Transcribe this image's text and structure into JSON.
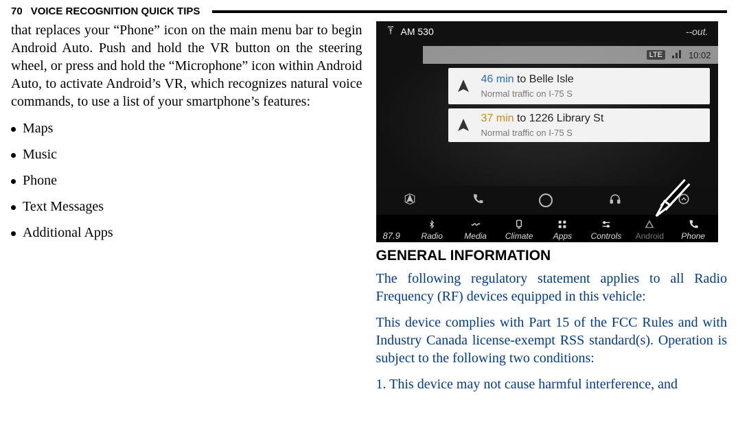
{
  "header": {
    "page_number": "70",
    "section": "VOICE RECOGNITION QUICK TIPS"
  },
  "left": {
    "paragraph": "that replaces your “Phone” icon on the main menu bar to begin Android Auto. Push and hold the VR button on the steering wheel, or press and hold the “Microphone” icon within Android Auto, to activate Android’s VR, which recognizes natural voice commands, to use a list of your smartphone’s features:",
    "bullets": [
      "Maps",
      "Music",
      "Phone",
      "Text Messages",
      "Additional Apps"
    ]
  },
  "right": {
    "heading": "GENERAL INFORMATION",
    "para1": "The following regulatory statement applies to all Radio Frequency (RF) devices equipped in this vehicle:",
    "para2": "This device complies with Part 15 of the FCC Rules and with Industry Canada license-exempt RSS standard(s). Operation is subject to the following two conditions:",
    "ol1_num": "1.",
    "ol1": "This device may not cause harmful interference, and"
  },
  "screenshot": {
    "top": {
      "tower_icon": "tower-icon",
      "station": "AM 530",
      "right": "--out."
    },
    "status": {
      "lte": "LTE",
      "time": "10:02"
    },
    "card1": {
      "mins": "46 min",
      "dest": " to Belle Isle",
      "sub": "Normal traffic on I-75 S"
    },
    "card2": {
      "mins": "37 min",
      "dest": " to 1226 Library St",
      "sub": "Normal traffic on I-75 S"
    },
    "bottom": {
      "preset": "87.9",
      "labels": [
        "Radio",
        "Media",
        "Climate",
        "Apps",
        "Controls",
        "Android",
        "Phone"
      ]
    }
  }
}
